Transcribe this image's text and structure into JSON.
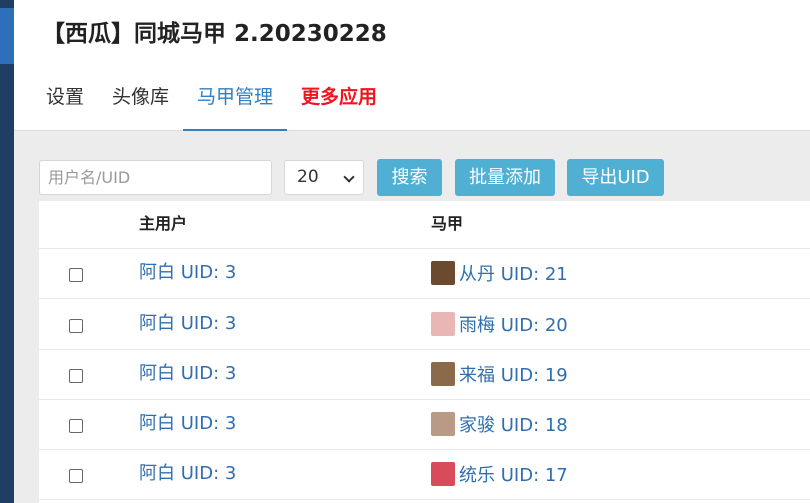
{
  "app_title": "【西瓜】同城马甲 2.20230228",
  "tabs": [
    {
      "label": "设置"
    },
    {
      "label": "头像库"
    },
    {
      "label": "马甲管理"
    },
    {
      "label": "更多应用"
    }
  ],
  "toolbar": {
    "search_placeholder": "用户名/UID",
    "page_size": "20",
    "search_label": "搜索",
    "batch_add_label": "批量添加",
    "export_label": "导出UID"
  },
  "table": {
    "headers": {
      "main_user": "主用户",
      "vest": "马甲"
    },
    "rows": [
      {
        "main_user": "阿白 UID: 3",
        "vest": "从丹 UID: 21",
        "avatar_color": "#6b4a2e"
      },
      {
        "main_user": "阿白 UID: 3",
        "vest": "雨梅 UID: 20",
        "avatar_color": "#e9b6b6"
      },
      {
        "main_user": "阿白 UID: 3",
        "vest": "来福 UID: 19",
        "avatar_color": "#8a6a4a"
      },
      {
        "main_user": "阿白 UID: 3",
        "vest": "家骏 UID: 18",
        "avatar_color": "#b89a86"
      },
      {
        "main_user": "阿白 UID: 3",
        "vest": "统乐 UID: 17",
        "avatar_color": "#d94b5a"
      }
    ]
  }
}
